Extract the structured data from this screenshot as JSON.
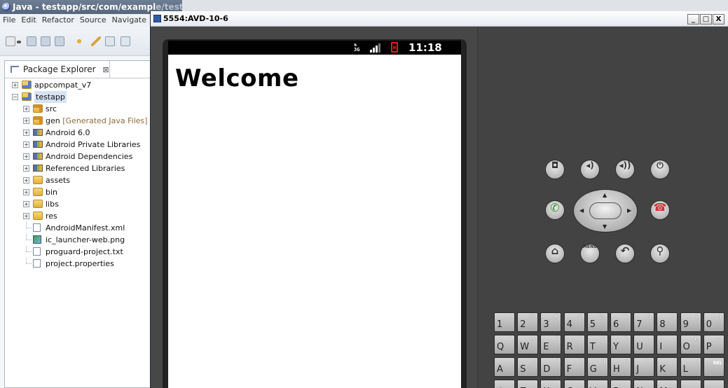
{
  "eclipse": {
    "title_visible": "Java - testapp/src/com/exampl",
    "title_hidden": "e/testapp/MainActivity.java - Eclipse SDK",
    "menu": [
      "File",
      "Edit",
      "Refactor",
      "Source",
      "Navigate"
    ],
    "package_explorer": {
      "tab_label": "Package Explorer",
      "close_glyph": "⊠",
      "tree": [
        {
          "label": "appcompat_v7",
          "icon": "project-icon",
          "depth": 0,
          "expandable": true,
          "expanded": false
        },
        {
          "label": "testapp",
          "icon": "project-icon",
          "depth": 0,
          "expandable": true,
          "expanded": true,
          "selected": true
        },
        {
          "label": "src",
          "icon": "source-folder-icon",
          "depth": 1,
          "expandable": true,
          "expanded": false
        },
        {
          "label": "gen",
          "suffix": "[Generated Java Files]",
          "icon": "generated-folder-icon",
          "depth": 1,
          "expandable": true,
          "expanded": false
        },
        {
          "label": "Android 6.0",
          "icon": "library-icon",
          "depth": 1,
          "expandable": true,
          "expanded": false
        },
        {
          "label": "Android Private Libraries",
          "icon": "library-icon",
          "depth": 1,
          "expandable": true,
          "expanded": false
        },
        {
          "label": "Android Dependencies",
          "icon": "library-icon",
          "depth": 1,
          "expandable": true,
          "expanded": false
        },
        {
          "label": "Referenced Libraries",
          "icon": "library-icon",
          "depth": 1,
          "expandable": true,
          "expanded": false
        },
        {
          "label": "assets",
          "icon": "folder-icon",
          "depth": 1,
          "expandable": true,
          "expanded": false
        },
        {
          "label": "bin",
          "icon": "folder-icon",
          "depth": 1,
          "expandable": true,
          "expanded": false
        },
        {
          "label": "libs",
          "icon": "folder-icon",
          "depth": 1,
          "expandable": true,
          "expanded": false
        },
        {
          "label": "res",
          "icon": "folder-icon",
          "depth": 1,
          "expandable": true,
          "expanded": false
        },
        {
          "label": "AndroidManifest.xml",
          "icon": "xml-file-icon",
          "depth": 1,
          "expandable": false
        },
        {
          "label": "ic_launcher-web.png",
          "icon": "image-file-icon",
          "depth": 1,
          "expandable": false
        },
        {
          "label": "proguard-project.txt",
          "icon": "text-file-icon",
          "depth": 1,
          "expandable": false
        },
        {
          "label": "project.properties",
          "icon": "text-file-icon",
          "depth": 1,
          "expandable": false
        }
      ]
    }
  },
  "emulator": {
    "title": "5554:AVD-10-6",
    "window_buttons": {
      "minimize": "_",
      "maximize": "□",
      "close": "X"
    },
    "status_bar": {
      "network": "3G",
      "time": "11:18"
    },
    "screen": {
      "heading": "Welcome"
    },
    "hardware_buttons": [
      {
        "name": "camera-button",
        "glyph": "◘"
      },
      {
        "name": "volume-down-button",
        "glyph": "◂)"
      },
      {
        "name": "volume-up-button",
        "glyph": "◂))"
      },
      {
        "name": "power-button",
        "glyph": "⏻"
      },
      {
        "name": "call-button",
        "glyph": "✆"
      },
      {
        "name": "end-call-button",
        "glyph": "☎"
      },
      {
        "name": "home-button",
        "glyph": "⌂"
      },
      {
        "name": "menu-button",
        "glyph": "MENU"
      },
      {
        "name": "back-button",
        "glyph": "↶"
      },
      {
        "name": "search-button",
        "glyph": "⚲"
      }
    ],
    "keyboard": {
      "row1": [
        {
          "main": "1",
          "alt": "!"
        },
        {
          "main": "2",
          "alt": "@"
        },
        {
          "main": "3",
          "alt": "#"
        },
        {
          "main": "4",
          "alt": "$"
        },
        {
          "main": "5",
          "alt": "%"
        },
        {
          "main": "6",
          "alt": "^"
        },
        {
          "main": "7",
          "alt": "&"
        },
        {
          "main": "8",
          "alt": "*"
        },
        {
          "main": "9",
          "alt": "("
        },
        {
          "main": "0",
          "alt": ")"
        }
      ],
      "row2": [
        {
          "main": "Q",
          "alt": "`"
        },
        {
          "main": "W",
          "alt": "~"
        },
        {
          "main": "E",
          "alt": "\""
        },
        {
          "main": "R",
          "alt": "`"
        },
        {
          "main": "T",
          "alt": "{"
        },
        {
          "main": "Y",
          "alt": "}"
        },
        {
          "main": "U",
          "alt": "-"
        },
        {
          "main": "I",
          "alt": "-"
        },
        {
          "main": "O",
          "alt": "+"
        },
        {
          "main": "P",
          "alt": "="
        }
      ],
      "row3": [
        {
          "main": "A",
          "alt": ""
        },
        {
          "main": "S",
          "alt": "\\"
        },
        {
          "main": "D",
          "alt": "'"
        },
        {
          "main": "F",
          "alt": "["
        },
        {
          "main": "G",
          "alt": "]"
        },
        {
          "main": "H",
          "alt": "<"
        },
        {
          "main": "J",
          "alt": ">"
        },
        {
          "main": "K",
          "alt": ";"
        },
        {
          "main": "L",
          "alt": ":"
        },
        {
          "main": "",
          "alt": "",
          "del": "DEL"
        }
      ],
      "row4": [
        {
          "main": "⇧",
          "alt": ""
        },
        {
          "main": "Z",
          "alt": ""
        },
        {
          "main": "X",
          "alt": ""
        },
        {
          "main": "C",
          "alt": ""
        },
        {
          "main": "V",
          "alt": ""
        },
        {
          "main": "B",
          "alt": ""
        },
        {
          "main": "N",
          "alt": ""
        },
        {
          "main": "M",
          "alt": ""
        },
        {
          "main": ".",
          "alt": ""
        },
        {
          "main": "↵",
          "alt": ""
        }
      ]
    }
  },
  "colors": {
    "emulator_bg": "#474747",
    "screen_bg": "#ffffff",
    "status_bar_bg": "#000000",
    "battery_red": "#e8191a",
    "call_green": "#2f8f2f",
    "end_call_red": "#d03030"
  }
}
